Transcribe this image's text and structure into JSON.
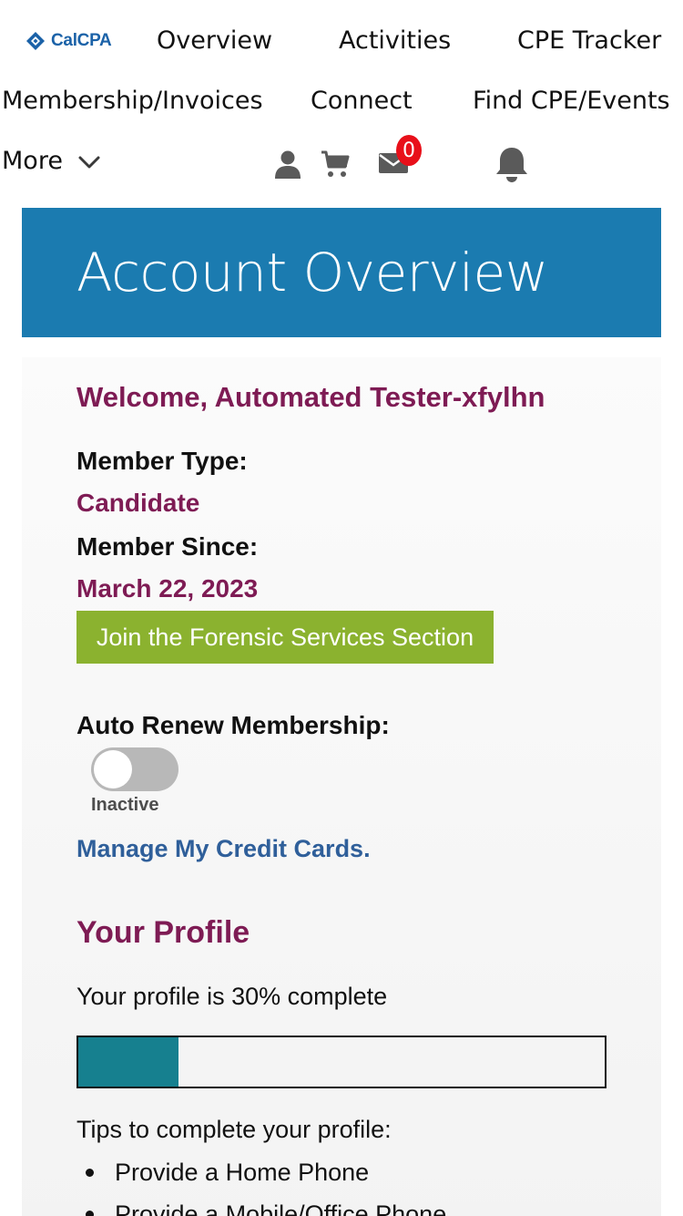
{
  "brand": {
    "logo_text": "CalCPA",
    "logo_color": "#1b62a8"
  },
  "nav": {
    "items": [
      {
        "label": "Overview"
      },
      {
        "label": "Activities"
      },
      {
        "label": "CPE Tracker"
      },
      {
        "label": "Membership/Invoices"
      },
      {
        "label": "Connect"
      },
      {
        "label": "Find CPE/Events"
      },
      {
        "label": "More"
      }
    ],
    "icons": [
      "user-icon",
      "cart-icon",
      "mail-icon",
      "bell-icon",
      "chevron-down-icon"
    ],
    "mail_badge_count": "0"
  },
  "hero": {
    "title": "Account Overview",
    "background_color": "#1b7bb0"
  },
  "account": {
    "welcome": "Welcome, Automated Tester-xfylhn",
    "member_type_label": "Member Type:",
    "member_type_value": "Candidate",
    "member_since_label": "Member Since:",
    "member_since_value": "March 22, 2023",
    "join_button_label": "Join the Forensic Services Section",
    "auto_renew_label": "Auto Renew Membership:",
    "auto_renew_enabled": false,
    "auto_renew_status": "Inactive",
    "manage_cards_link": "Manage My Credit Cards."
  },
  "profile": {
    "title": "Your Profile",
    "completion_text": "Your profile is 30% complete",
    "completion_fraction": 0.19,
    "tips_heading": "Tips to complete your profile:",
    "tips": [
      "Provide a Home Phone",
      "Provide a Mobile/Office Phone"
    ]
  },
  "colors": {
    "accent_purple": "#7e1b54",
    "link_blue": "#2f5f9a",
    "button_green": "#8bb22f",
    "progress_teal": "#16808f",
    "badge_red": "#e8101a"
  }
}
